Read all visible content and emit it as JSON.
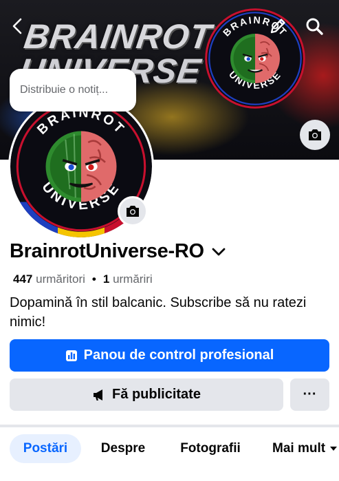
{
  "cover": {
    "title_line1": "BRAINROT",
    "title_line2": "UNIVERSE",
    "logo_top_text": "BRAINROT",
    "logo_bottom_text": "UNIVERSE"
  },
  "note": {
    "placeholder": "Distribuie o notiț..."
  },
  "profile": {
    "name": "BrainrotUniverse-RO",
    "followers_count": "447",
    "followers_label": "urmăritori",
    "following_count": "1",
    "following_label": "urmăriri",
    "bio": "Dopamină în stil balcanic. Subscribe să nu ratezi nimic!"
  },
  "actions": {
    "dashboard_label": "Panou de control profesional",
    "advertise_label": "Fă publicitate",
    "more_label": "···"
  },
  "tabs": [
    {
      "label": "Postări",
      "active": true
    },
    {
      "label": "Despre",
      "active": false
    },
    {
      "label": "Fotografii",
      "active": false
    },
    {
      "label": "Mai mult",
      "active": false
    }
  ],
  "colors": {
    "primary": "#0866ff",
    "secondary_bg": "#e4e6eb",
    "active_tab_bg": "#e7f0ff",
    "muted_text": "#65676b"
  },
  "icons": {
    "back": "chevron-left-icon",
    "edit": "pencil-icon",
    "search": "search-icon",
    "camera": "camera-icon",
    "dropdown": "chevron-down-icon",
    "dashboard": "bar-chart-icon",
    "advertise": "megaphone-icon",
    "tab_more": "caret-down-icon"
  }
}
